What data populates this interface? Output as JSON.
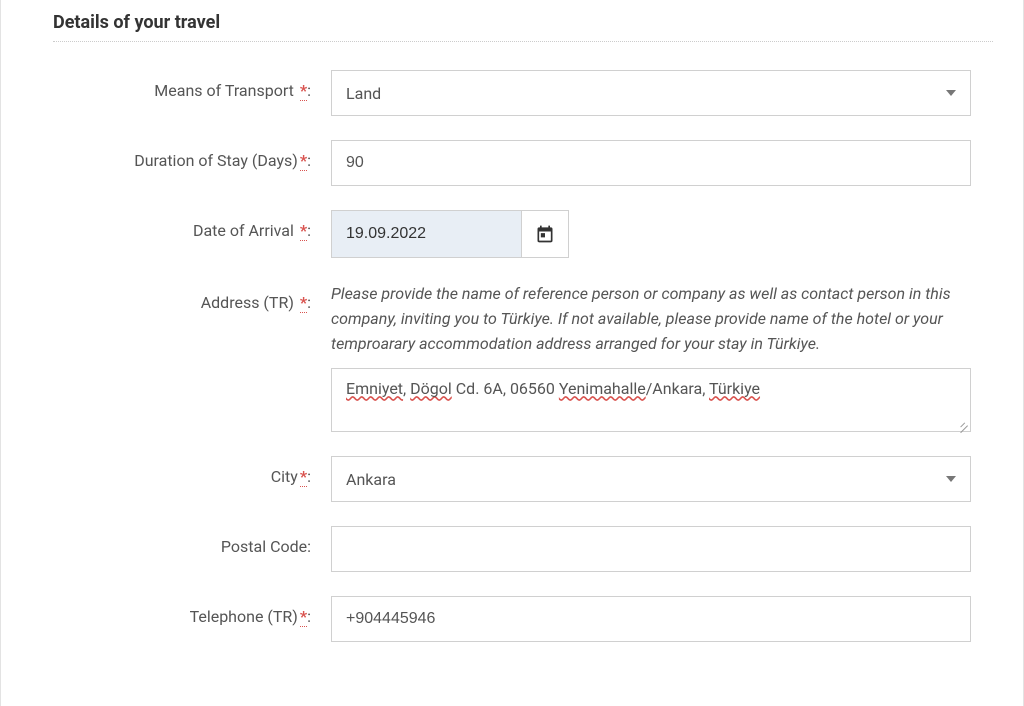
{
  "section": {
    "title": "Details of your travel"
  },
  "labels": {
    "transport": "Means of Transport",
    "duration": "Duration of Stay (Days)",
    "arrival": "Date of Arrival",
    "address": "Address (TR)",
    "city": "City",
    "postal": "Postal Code",
    "telephone": "Telephone (TR)"
  },
  "required_marker": "*",
  "fields": {
    "transport": {
      "value": "Land"
    },
    "duration": {
      "value": "90"
    },
    "arrival": {
      "value": "19.09.2022"
    },
    "address_hint": "Please provide the name of reference person or company as well as contact person in this company, inviting you to Türkiye. If not available, please provide name of the hotel or your temproarary accommodation address arranged for your stay in Türkiye.",
    "address_parts": {
      "p1": "Emniyet",
      "sep1": ", ",
      "p2": "Dögol",
      "sep2": " Cd. 6A, 06560 ",
      "p3": "Yenimahalle",
      "sep3": "/Ankara, ",
      "p4": "Türkiye"
    },
    "city": {
      "value": "Ankara"
    },
    "postal": {
      "value": ""
    },
    "telephone": {
      "value": "+904445946"
    }
  }
}
